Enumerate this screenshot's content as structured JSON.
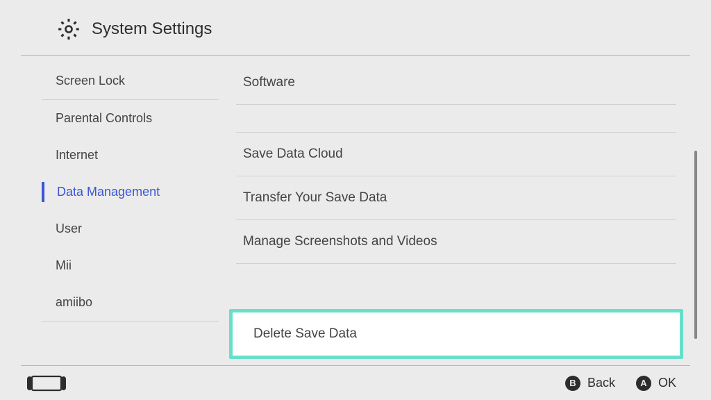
{
  "header": {
    "title": "System Settings"
  },
  "sidebar": {
    "items": [
      {
        "label": "Screen Lock",
        "active": false
      },
      {
        "label": "Parental Controls",
        "active": false
      },
      {
        "label": "Internet",
        "active": false
      },
      {
        "label": "Data Management",
        "active": true
      },
      {
        "label": "User",
        "active": false
      },
      {
        "label": "Mii",
        "active": false
      },
      {
        "label": "amiibo",
        "active": false
      }
    ]
  },
  "main": {
    "items": [
      {
        "label": "Software",
        "highlighted": false
      },
      {
        "label": "Save Data Cloud",
        "highlighted": false
      },
      {
        "label": "Transfer Your Save Data",
        "highlighted": false
      },
      {
        "label": "Manage Screenshots and Videos",
        "highlighted": false
      },
      {
        "label": "Delete Save Data",
        "highlighted": true
      }
    ]
  },
  "footer": {
    "back_button_letter": "B",
    "back_label": "Back",
    "ok_button_letter": "A",
    "ok_label": "OK"
  }
}
